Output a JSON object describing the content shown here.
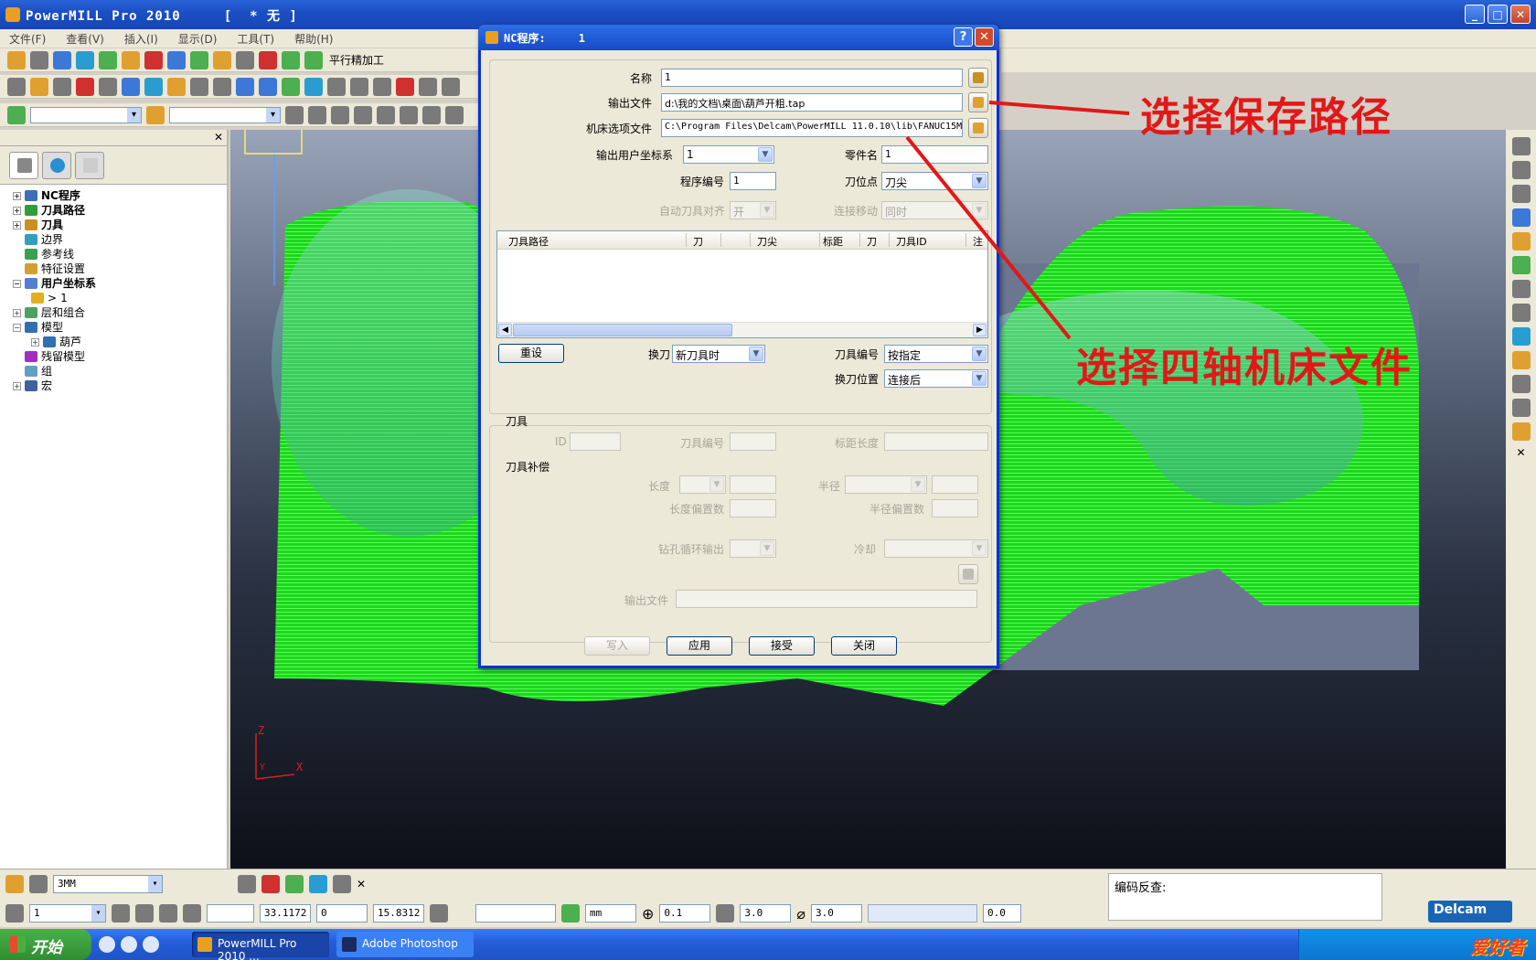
{
  "app": {
    "title": "PowerMILL Pro 2010     [  * 无 ]"
  },
  "menu": [
    "文件(F)",
    "查看(V)",
    "插入(I)",
    "显示(D)",
    "工具(T)",
    "帮助(H)"
  ],
  "toolbar": {
    "strategy_label": "平行精加工"
  },
  "explorer": {
    "items": [
      {
        "label": "NC程序",
        "bold": true,
        "icon_color": "#3c6fb8"
      },
      {
        "label": "刀具路径",
        "bold": true,
        "icon_color": "#2f9d3a"
      },
      {
        "label": "刀具",
        "bold": true,
        "icon_color": "#c89020"
      },
      {
        "label": "边界",
        "bold": false,
        "icon_color": "#30a0c0"
      },
      {
        "label": "参考线",
        "bold": false,
        "icon_color": "#3aa050"
      },
      {
        "label": "特征设置",
        "bold": false,
        "icon_color": "#d0a030"
      },
      {
        "label": "用户坐标系",
        "bold": true,
        "icon_color": "#5080d0"
      },
      {
        "label": "1",
        "bold": false,
        "icon_color": "#e0b020"
      },
      {
        "label": "层和组合",
        "bold": false,
        "icon_color": "#50a060"
      },
      {
        "label": "模型",
        "bold": false,
        "icon_color": "#3070b0"
      },
      {
        "label": "葫芦",
        "bold": false,
        "icon_color": "#3070b0"
      },
      {
        "label": "残留模型",
        "bold": false,
        "icon_color": "#a030c0"
      },
      {
        "label": "组",
        "bold": false,
        "icon_color": "#60a0c0"
      },
      {
        "label": "宏",
        "bold": false,
        "icon_color": "#4060a0"
      }
    ]
  },
  "viewport": {
    "axis_z": "Z",
    "axis_x": "X",
    "axis_y": "Y",
    "toolpath_color": "#22ee22"
  },
  "dialog": {
    "title": "NC程序:     1",
    "help": "?",
    "close": "✕",
    "name_label": "名称",
    "name_value": "1",
    "output_file_label": "输出文件",
    "output_file_value": "d:\\我的文档\\桌面\\葫芦开粗.tap",
    "machine_file_label": "机床选项文件",
    "machine_file_value": "C:\\Program Files\\Delcam\\PowerMILL 11.0.10\\lib\\FANUC15M-",
    "ucs_label": "输出用户坐标系",
    "ucs_value": "1",
    "part_label": "零件名",
    "part_value": "1",
    "prog_no_label": "程序编号",
    "prog_no_value": "1",
    "tool_point_label": "刀位点",
    "tool_point_value": "刀尖",
    "auto_align_label": "自动刀具对齐",
    "auto_align_value": "开",
    "link_move_label": "连接移动",
    "link_move_value": "同时",
    "columns": [
      "刀具路径",
      "刀",
      "",
      "刀尖",
      "",
      "标距",
      "刀",
      "刀具ID",
      "注"
    ],
    "reset_btn": "重设",
    "tool_change_label": "换刀",
    "tool_change_value": "新刀具时",
    "tool_number_label": "刀具编号",
    "tool_number_value": "按指定",
    "change_pos_label": "换刀位置",
    "change_pos_value": "连接后",
    "tool_group": "刀具",
    "id_label": "ID",
    "tool_no_label": "刀具编号",
    "gauge_label": "标距长度",
    "comp_group": "刀具补偿",
    "length_label": "长度",
    "radius_label": "半径",
    "len_offset_label": "长度偏置数",
    "rad_offset_label": "半径偏置数",
    "drill_label": "钻孔循环输出",
    "coolant_label": "冷却",
    "out_file2_label": "输出文件",
    "write_btn": "写入",
    "apply_btn": "应用",
    "accept_btn": "接受",
    "close_btn": "关闭"
  },
  "annotations": {
    "save_path": "选择保存路径",
    "machine_file": "选择四轴机床文件",
    "color": "#e21818"
  },
  "statusbar": {
    "tool_value": "3MM",
    "ucs_value": "1",
    "x": "33.1172",
    "y": "0",
    "z": "15.8312",
    "units": "mm",
    "tolerance": "0.1",
    "stock": "3.0",
    "diameter": "3.0",
    "thickness": "0.0",
    "feedback_label": "编码反查:",
    "brand": "Delcam"
  },
  "taskbar": {
    "start": "开始",
    "tasks": [
      "PowerMILL Pro 2010 ...",
      "Adobe Photoshop"
    ],
    "tray_logo": "爱好者"
  }
}
